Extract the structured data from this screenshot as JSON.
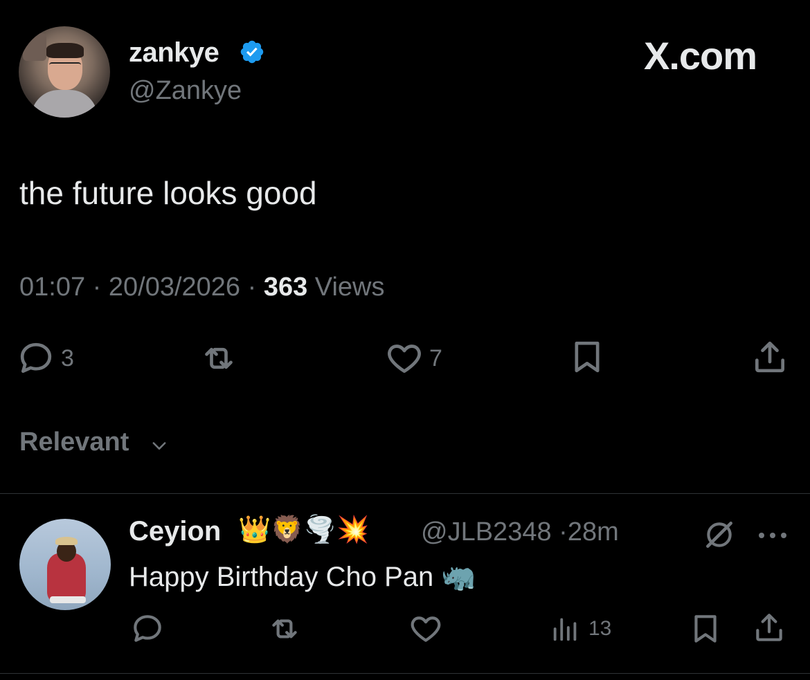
{
  "brand": {
    "label": "X.com"
  },
  "tweet": {
    "author": {
      "display_name": "zankye",
      "handle": "@Zankye",
      "verified": true,
      "avatar_icon": "user-avatar-photo"
    },
    "text": "the future looks good",
    "time": "01:07",
    "date": "20/03/2026",
    "sep": "·",
    "views_count": "363",
    "views_label": " Views",
    "actions": {
      "replies": "3",
      "reposts": "",
      "likes": "7"
    }
  },
  "sort": {
    "label": "Relevant"
  },
  "reply": {
    "author": {
      "display_name": "Ceyion",
      "emojis": "👑🦁🌪️💥",
      "handle": "@JLB2348",
      "sep": "·",
      "age": "28m"
    },
    "text": "Happy Birthday Cho Pan 🦏",
    "actions": {
      "views": "13"
    }
  },
  "colors": {
    "background": "#000000",
    "primary_text": "#e7e9ea",
    "secondary_text": "#71767b",
    "verified_blue": "#1d9bf0",
    "divider": "#2f3336"
  }
}
